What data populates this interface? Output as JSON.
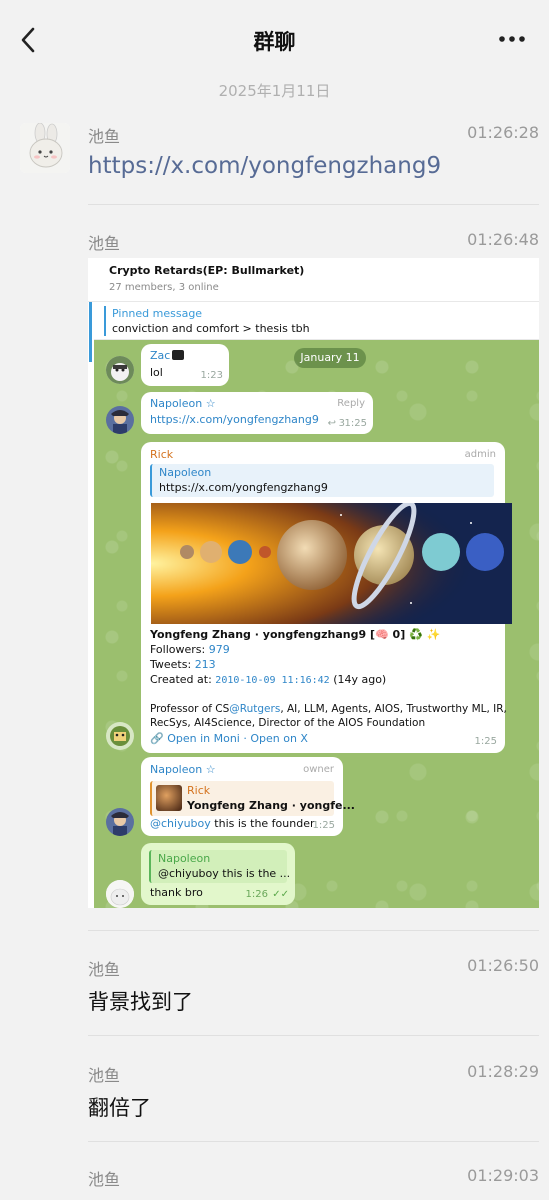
{
  "header": {
    "title": "群聊",
    "back_icon": "chevron-left-icon",
    "more_icon": "more-dots-icon"
  },
  "chat": {
    "date": "2025年1月11日",
    "messages": [
      {
        "sender": "池鱼",
        "time": "01:26:28",
        "text": "https://x.com/yongfengzhang9"
      },
      {
        "sender": "池鱼",
        "time": "01:26:48"
      },
      {
        "sender": "池鱼",
        "time": "01:26:50",
        "text": "背景找到了"
      },
      {
        "sender": "池鱼",
        "time": "01:28:29",
        "text": "翻倍了"
      },
      {
        "sender": "池鱼",
        "time": "01:29:03"
      }
    ]
  },
  "telegram": {
    "group_title": "Crypto Retards(EP: Bullmarket)",
    "group_sub": "27 members, 3 online",
    "pinned_label": "Pinned message",
    "pinned_text": "conviction and comfort > thesis tbh",
    "date_pill": "January 11",
    "m1": {
      "name": "Zac",
      "text": "lol",
      "time": "1:23"
    },
    "m2": {
      "name": "Napoleon ☆",
      "reply_label": "Reply",
      "link": "https://x.com/yongfengzhang9",
      "replies": "3",
      "time": "1:25"
    },
    "m3": {
      "name": "Rick",
      "badge": "admin",
      "quote_name": "Napoleon",
      "quote_text": "https://x.com/yongfengzhang9",
      "profile_title": "Yongfeng Zhang · yongfengzhang9 [🧠 0] ♻️ ✨",
      "followers_label": "Followers:",
      "followers": "979",
      "tweets_label": "Tweets:",
      "tweets": "213",
      "created_label": "Created at:",
      "created": "2010-10-09 11:16:42",
      "created_ago": "(14y ago)",
      "bio_1": "Professor of CS",
      "bio_rutgers": "@Rutgers",
      "bio_1b": ", AI, LLM, Agents, AIOS, Trustworthy ML, IR,",
      "bio_2": "RecSys, AI4Science, Director of the AIOS Foundation",
      "links": "🔗 Open in Moni · Open on X",
      "time": "1:25"
    },
    "m4": {
      "name": "Napoleon ☆",
      "badge": "owner",
      "quote_name": "Rick",
      "quote_text": "Yongfeng Zhang · yongfe...",
      "mention": "@chiyuboy",
      "text": " this is the founder",
      "time": "1:25"
    },
    "m5": {
      "quote_name": "Napoleon",
      "quote_text": "@chiyuboy  this is the ...",
      "text": "thank bro",
      "time": "1:26",
      "ticks": "✓✓"
    }
  },
  "colors": {
    "link": "#576b95",
    "tg_accent": "#3a9ad9",
    "tg_bg": "#9bbf6e"
  }
}
